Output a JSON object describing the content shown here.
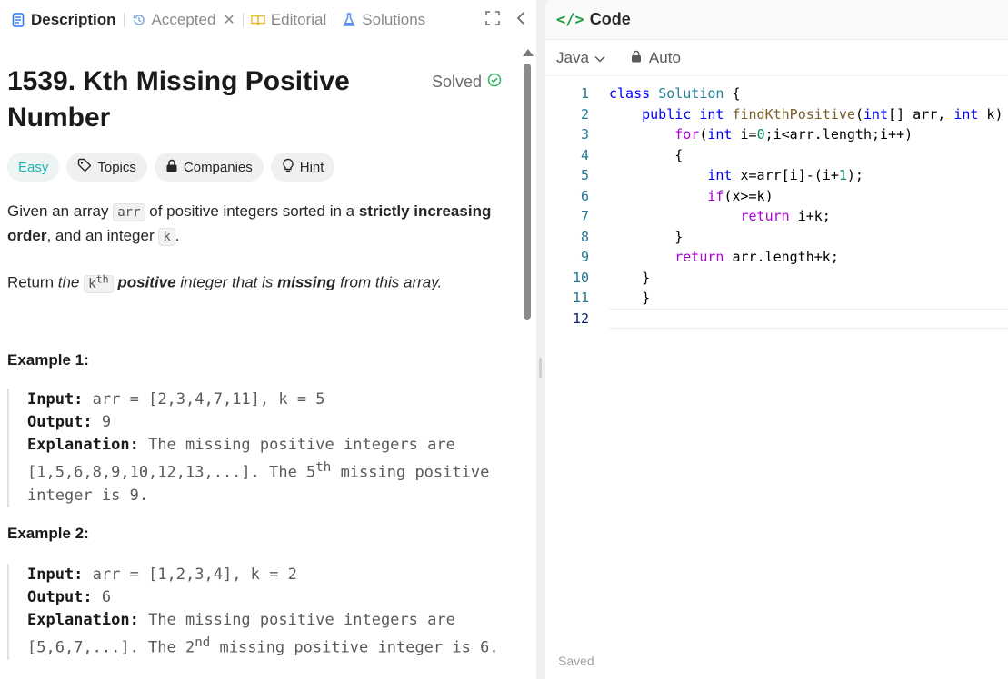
{
  "tabs": {
    "description": "Description",
    "accepted": "Accepted",
    "editorial": "Editorial",
    "solutions": "Solutions"
  },
  "problem": {
    "title": "1539. Kth Missing Positive Number",
    "solved_label": "Solved",
    "difficulty": "Easy",
    "chips": {
      "topics": "Topics",
      "companies": "Companies",
      "hint": "Hint"
    }
  },
  "description": {
    "p1_a": "Given an array ",
    "p1_code1": "arr",
    "p1_b": " of positive integers sorted in a ",
    "p1_bold": "strictly increasing order",
    "p1_c": ", and an integer ",
    "p1_code2": "k",
    "p1_d": ".",
    "p2_a": "Return ",
    "p2_the": "the",
    "p2_code": "k",
    "p2_sup": "th",
    "p2_positive": "positive",
    "p2_b": "integer that is",
    "p2_missing": "missing",
    "p2_c": "from this array."
  },
  "examples": [
    {
      "heading": "Example 1:",
      "input_label": "Input:",
      "input": "arr = [2,3,4,7,11], k = 5",
      "output_label": "Output:",
      "output": "9",
      "explanation_label": "Explanation:",
      "explanation_a": "The missing positive integers are [1,5,6,8,9,10,12,13,...]. The 5",
      "explanation_sup": "th",
      "explanation_b": " missing positive integer is 9."
    },
    {
      "heading": "Example 2:",
      "input_label": "Input:",
      "input": "arr = [1,2,3,4], k = 2",
      "output_label": "Output:",
      "output": "6",
      "explanation_label": "Explanation:",
      "explanation_a": "The missing positive integers are [5,6,7,...]. The 2",
      "explanation_sup": "nd",
      "explanation_b": " missing positive integer is 6."
    }
  ],
  "editor": {
    "panel_title": "Code",
    "language": "Java",
    "mode": "Auto",
    "status": "Saved",
    "line_numbers": [
      "1",
      "2",
      "3",
      "4",
      "5",
      "6",
      "7",
      "8",
      "9",
      "10",
      "11",
      "12"
    ]
  },
  "colors": {
    "easy": "#1cb8b8",
    "solved_check": "#2db55d",
    "code_icon": "#1e9e3e",
    "keyword": "#0000ff",
    "control": "#af00db",
    "type": "#267f99",
    "number": "#098658"
  },
  "icons": {
    "description": "document-icon",
    "accepted": "history-icon",
    "editorial": "book-icon",
    "solutions": "flask-icon",
    "topics": "tag-icon",
    "companies": "lock-icon",
    "hint": "lightbulb-icon",
    "code": "code-brackets-icon"
  }
}
